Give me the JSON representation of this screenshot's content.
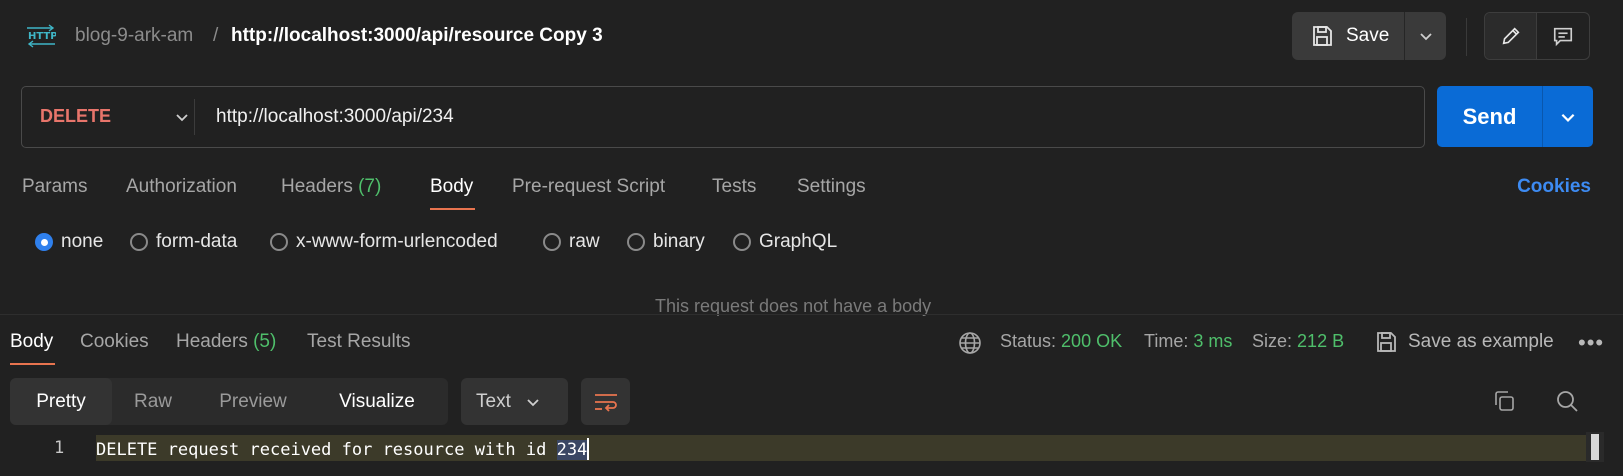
{
  "header": {
    "icon": "http-icon",
    "breadcrumb_parent": "blog-9-ark-am",
    "breadcrumb_separator": "/",
    "title": "http://localhost:3000/api/resource Copy 3",
    "save_label": "Save"
  },
  "request": {
    "method": "DELETE",
    "url": "http://localhost:3000/api/234",
    "send_label": "Send"
  },
  "request_tabs": [
    {
      "label": "Params",
      "count": ""
    },
    {
      "label": "Authorization",
      "count": ""
    },
    {
      "label": "Headers",
      "count": "(7)"
    },
    {
      "label": "Body",
      "count": "",
      "active": true
    },
    {
      "label": "Pre-request Script",
      "count": ""
    },
    {
      "label": "Tests",
      "count": ""
    },
    {
      "label": "Settings",
      "count": ""
    }
  ],
  "cookies_link": "Cookies",
  "body_types": [
    {
      "label": "none",
      "checked": true
    },
    {
      "label": "form-data",
      "checked": false
    },
    {
      "label": "x-www-form-urlencoded",
      "checked": false
    },
    {
      "label": "raw",
      "checked": false
    },
    {
      "label": "binary",
      "checked": false
    },
    {
      "label": "GraphQL",
      "checked": false
    }
  ],
  "no_body_message": "This request does not have a body",
  "response": {
    "tabs": [
      {
        "label": "Body",
        "count": "",
        "active": true
      },
      {
        "label": "Cookies",
        "count": ""
      },
      {
        "label": "Headers",
        "count": "(5)"
      },
      {
        "label": "Test Results",
        "count": ""
      }
    ],
    "status_label": "Status:",
    "status_value": "200 OK",
    "time_label": "Time:",
    "time_value": "3 ms",
    "size_label": "Size:",
    "size_value": "212 B",
    "save_example_label": "Save as example",
    "more": "•••",
    "views": [
      {
        "label": "Pretty",
        "active": true
      },
      {
        "label": "Raw"
      },
      {
        "label": "Preview"
      },
      {
        "label": "Visualize"
      }
    ],
    "format": "Text",
    "code": {
      "line_number": "1",
      "text_before": "DELETE request received for resource with id ",
      "text_selected": "234"
    }
  },
  "colors": {
    "accent_blue": "#0a6bd6",
    "method_delete": "#e8756b",
    "success_green": "#4fbf6b",
    "tab_underline": "#e8744f"
  }
}
